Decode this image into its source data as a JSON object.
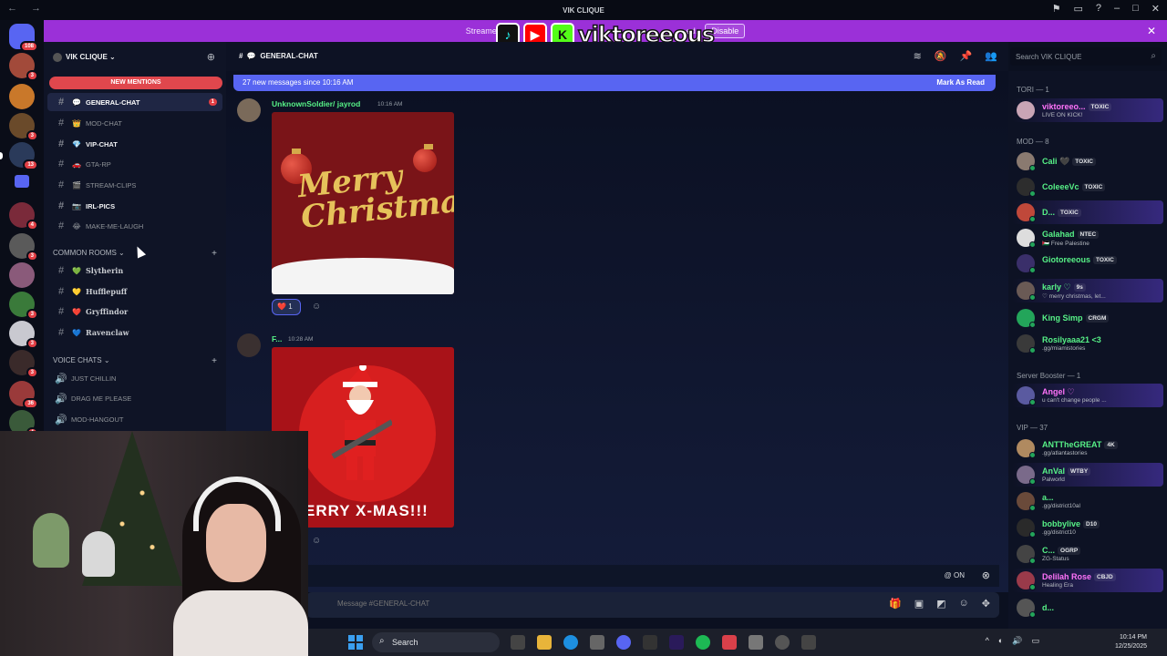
{
  "window": {
    "title": "VIK CLIQUE",
    "nav": "← →"
  },
  "banner": {
    "text_left": "Streame",
    "text_right": "ed.",
    "disable_label": "Disable",
    "close": "✕",
    "overlay_name": "viktoreeous"
  },
  "rail": {
    "badges": [
      "108",
      "3",
      "3",
      "13",
      "4",
      "3",
      "3",
      "3",
      "3",
      "36",
      "4"
    ]
  },
  "sidebar": {
    "server_name": "VIK CLIQUE",
    "new_mentions": "NEW MENTIONS",
    "channels": [
      {
        "icon": "💬",
        "label": "GENERAL-CHAT",
        "badge": "1"
      },
      {
        "icon": "👑",
        "label": "MOD-CHAT"
      },
      {
        "icon": "💎",
        "label": "VIP-CHAT"
      },
      {
        "icon": "🚗",
        "label": "GTA-RP"
      },
      {
        "icon": "🎬",
        "label": "STREAM-CLIPS"
      },
      {
        "icon": "📷",
        "label": "IRL-PICS"
      },
      {
        "icon": "😂",
        "label": "MAKE-ME-LAUGH"
      }
    ],
    "common_rooms": {
      "title": "COMMON ROOMS",
      "items": [
        {
          "icon": "💚",
          "label": "Slytherin"
        },
        {
          "icon": "💛",
          "label": "Hufflepuff"
        },
        {
          "icon": "❤️",
          "label": "Gryffindor"
        },
        {
          "icon": "💙",
          "label": "Ravenclaw"
        }
      ]
    },
    "voice": {
      "title": "VOICE CHATS",
      "items": [
        "JUST CHILLIN",
        "DRAG ME PLEASE",
        "MOD-HANGOUT"
      ]
    }
  },
  "header": {
    "channel": "GENERAL-CHAT",
    "search_placeholder": "Search VIK CLIQUE"
  },
  "chat": {
    "new_messages": "27 new messages since 10:16 AM",
    "mark_as_read": "Mark As Read",
    "messages": [
      {
        "author": "UnknownSoldier/ jayrod",
        "time": "10:16 AM",
        "image_text": "Merry Christmas",
        "reaction_emoji": "❤️",
        "reaction_count": "1"
      },
      {
        "author": "F...",
        "time": "10:28 AM",
        "image_text": "ERRY X-MAS!!!"
      }
    ]
  },
  "composer": {
    "mention_toggle": "@ ON",
    "placeholder": "Message #GENERAL-CHAT"
  },
  "members": {
    "groups": [
      {
        "title": "TORI — 1",
        "members": [
          {
            "name": "viktoreeo...",
            "tag": "TOXIC",
            "status": "LIVE ON KICK!",
            "color": "#ff73fa",
            "avatar": "#c9a5b5"
          }
        ]
      },
      {
        "title": "MOD — 8",
        "members": [
          {
            "name": "Cali 🖤",
            "tag": "TOXIC",
            "status": "",
            "color": "#57f287",
            "avatar": "#8a7a70"
          },
          {
            "name": "ColeeeVc",
            "tag": "TOXIC",
            "status": "",
            "color": "#57f287",
            "avatar": "#2d2d2d"
          },
          {
            "name": "D...",
            "tag": "TOXIC",
            "status": "",
            "color": "#57f287",
            "avatar": "#c0483a"
          },
          {
            "name": "Galahad",
            "tag": "NTEC",
            "status": "🇵🇸 Free Palestine",
            "color": "#57f287",
            "avatar": "#ddd"
          },
          {
            "name": "Giotoreeous",
            "tag": "TOXIC",
            "status": "",
            "color": "#57f287",
            "avatar": "#3a2f6a"
          },
          {
            "name": "karly ♡",
            "tag": "9s",
            "status": "♡ merry christmas, let...",
            "color": "#57f287",
            "avatar": "#6a5a55"
          },
          {
            "name": "King Simp",
            "tag": "CRGM",
            "status": "",
            "color": "#57f287",
            "avatar": "#23a55a"
          },
          {
            "name": "Rosilyaaa21 <3",
            "tag": "",
            "status": ".gg/miamistories",
            "color": "#57f287",
            "avatar": "#3a3a3a"
          }
        ]
      },
      {
        "title": "Server Booster — 1",
        "members": [
          {
            "name": "Angel ♡",
            "tag": "",
            "status": "u can't change people ...",
            "color": "#ff73fa",
            "avatar": "#5a5aa0"
          }
        ]
      },
      {
        "title": "VIP — 37",
        "members": [
          {
            "name": "ANTTheGREAT",
            "tag": "4K",
            "status": ".gg/atlantastories",
            "color": "#57f287",
            "avatar": "#b08a60"
          },
          {
            "name": "AnVal",
            "tag": "WTBY",
            "status": "Palworld",
            "color": "#57f287",
            "avatar": "#7a6a8a"
          },
          {
            "name": "a...",
            "tag": "",
            "status": ".gg/district10al",
            "color": "#57f287",
            "avatar": "#6a4a3a"
          },
          {
            "name": "bobbylive",
            "tag": "D10",
            "status": ".gg/district10",
            "color": "#57f287",
            "avatar": "#2a2a2a"
          },
          {
            "name": "C...",
            "tag": "OGRP",
            "status": "ZG-Status",
            "color": "#57f287",
            "avatar": "#444"
          },
          {
            "name": "Delilah Rose",
            "tag": "CBJD",
            "status": "Healing Era",
            "color": "#ff73fa",
            "avatar": "#9a3a4a"
          },
          {
            "name": "d...",
            "tag": "",
            "status": "",
            "color": "#57f287",
            "avatar": "#555"
          }
        ]
      }
    ]
  },
  "taskbar": {
    "search": "Search",
    "time": "10:14 PM",
    "date": "12/25/2025"
  }
}
